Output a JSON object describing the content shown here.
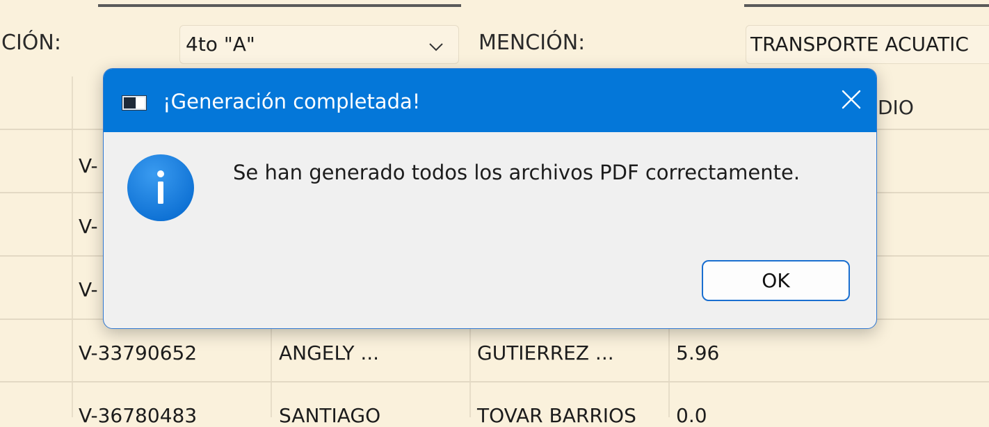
{
  "form": {
    "section_label": "CIÓN:",
    "section_value": "4to \"A\"",
    "mention_label": "MENCIÓN:",
    "mention_value": "TRANSPORTE ACUATIC"
  },
  "table": {
    "header_partial": "DIO",
    "rows": [
      {
        "id": "V-"
      },
      {
        "id": "V-"
      },
      {
        "id": "V-"
      },
      {
        "id": "V-33790652",
        "name": "ANGELY ...",
        "surname": "GUTIERREZ ...",
        "average": "5.96"
      },
      {
        "id": "V-36780483",
        "name": "SANTIAGO",
        "surname": "TOVAR BARRIOS",
        "average": "0.0"
      }
    ]
  },
  "dialog": {
    "title": "¡Generación completada!",
    "message": "Se han generado todos los archivos PDF correctamente.",
    "ok_label": "OK",
    "icons": {
      "app": "window-app-icon",
      "info": "info-icon",
      "close": "close-icon"
    },
    "colors": {
      "titlebar": "#0477d9",
      "info_icon": "#1a7fdf",
      "button_border": "#1a6fd0"
    }
  }
}
